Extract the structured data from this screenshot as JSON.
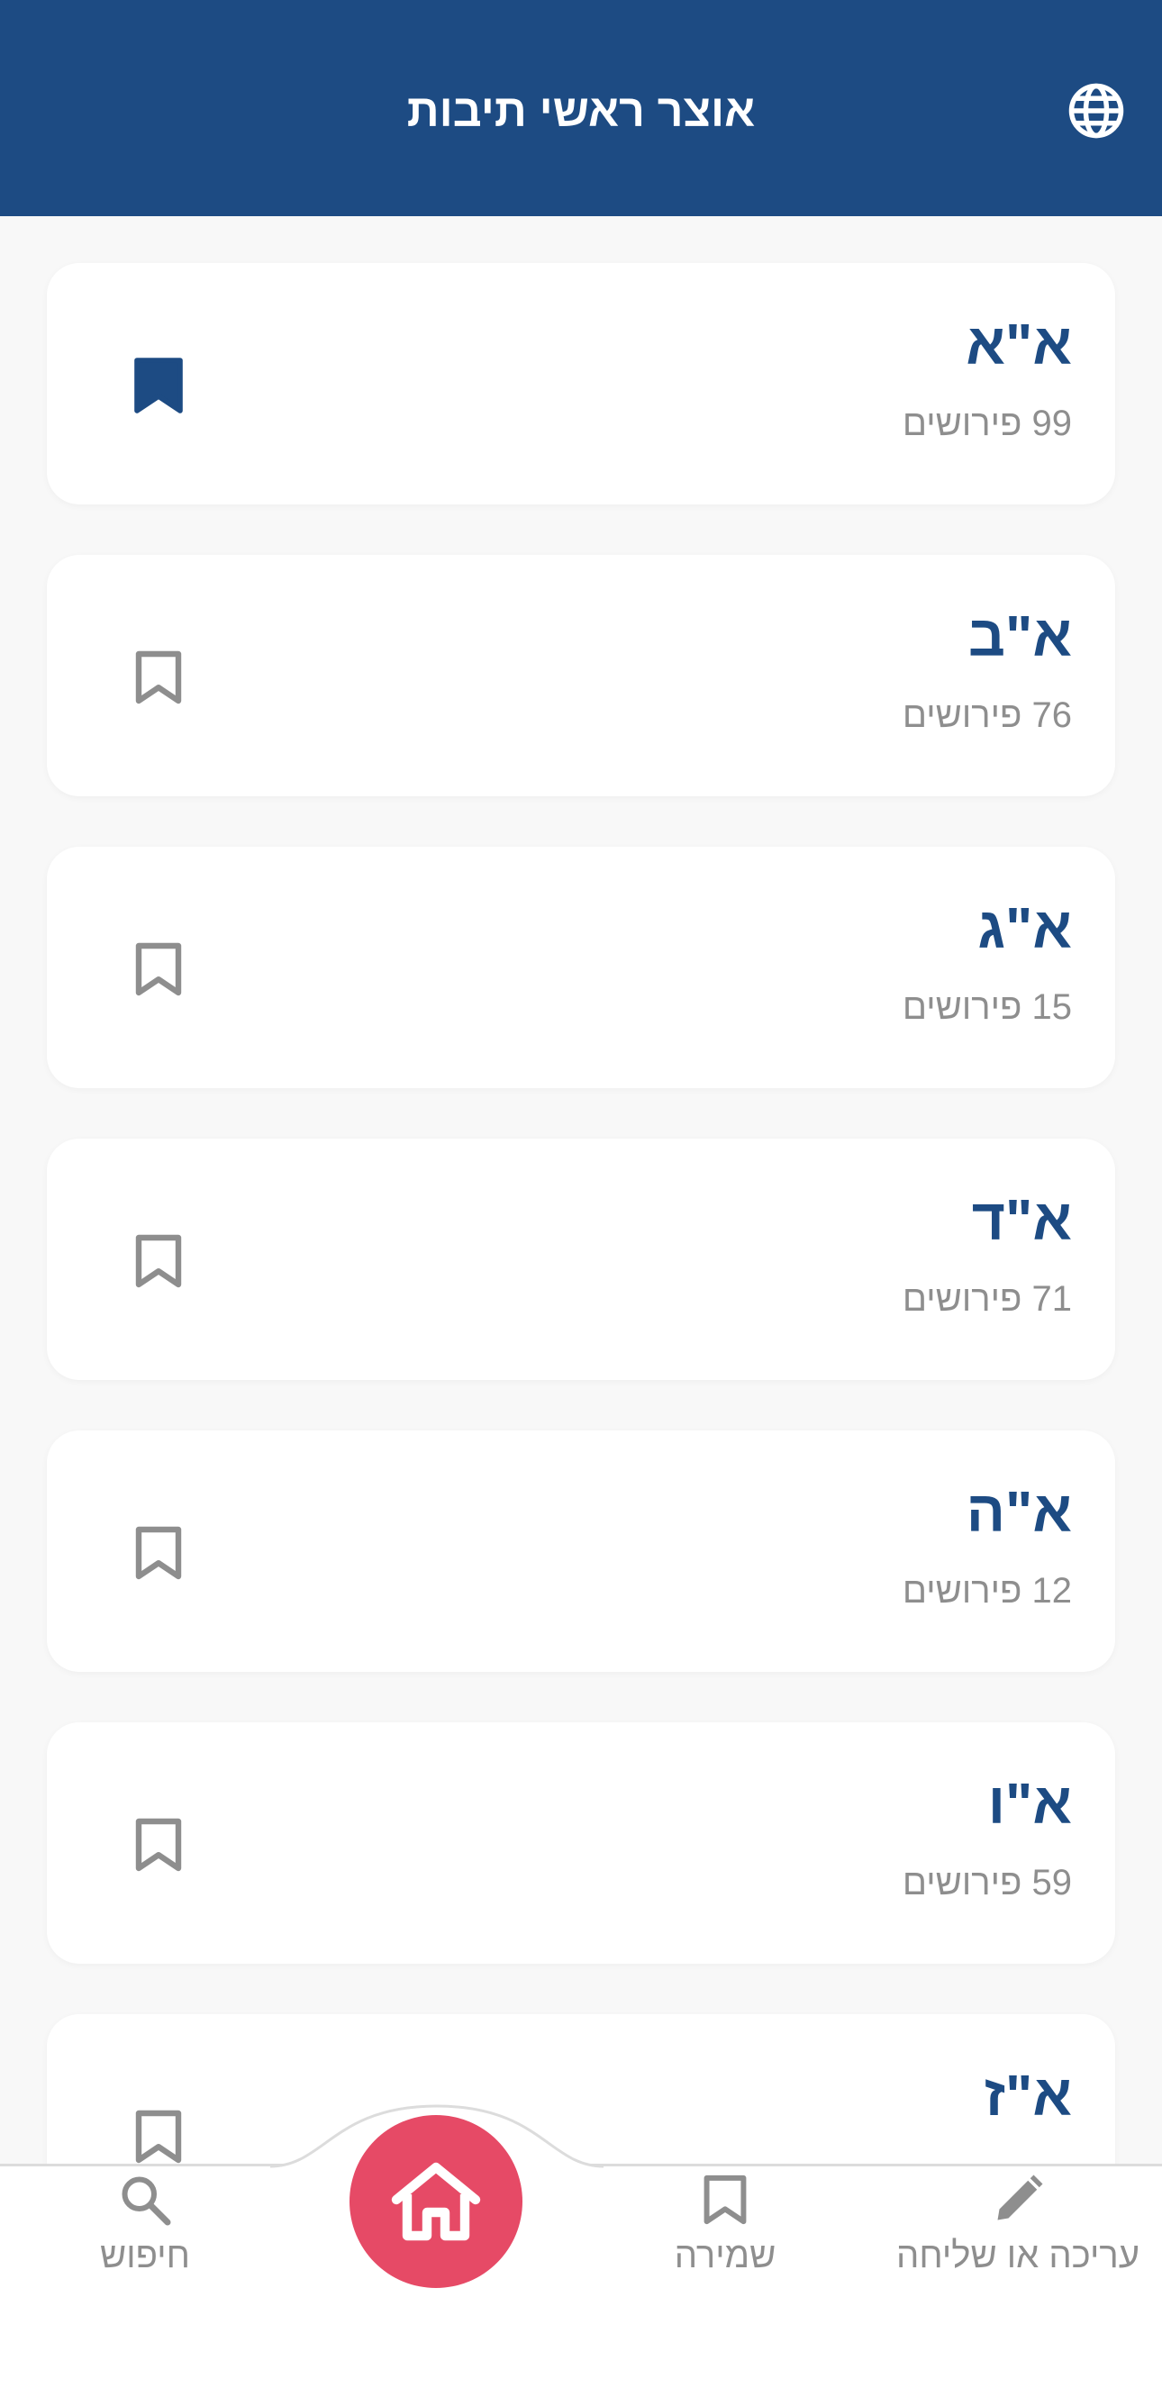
{
  "header": {
    "title": "אוצר ראשי תיבות",
    "language_icon": "globe-icon"
  },
  "colors": {
    "brand": "#1d4b83",
    "accent": "#e64a66",
    "muted": "#8e8e8e"
  },
  "items": [
    {
      "abbr": "א\"א",
      "count": "99 פירושים",
      "saved": true
    },
    {
      "abbr": "א\"ב",
      "count": "76 פירושים",
      "saved": false
    },
    {
      "abbr": "א\"ג",
      "count": "15 פירושים",
      "saved": false
    },
    {
      "abbr": "א\"ד",
      "count": "71 פירושים",
      "saved": false
    },
    {
      "abbr": "א\"ה",
      "count": "12 פירושים",
      "saved": false
    },
    {
      "abbr": "א\"ו",
      "count": "59 פירושים",
      "saved": false
    },
    {
      "abbr": "א\"ז",
      "count": "",
      "saved": false
    }
  ],
  "nav": {
    "search": {
      "label": "חיפוש",
      "icon": "search-icon"
    },
    "home": {
      "icon": "home-icon"
    },
    "saved": {
      "label": "שמירה",
      "icon": "bookmark-icon"
    },
    "edit": {
      "label": "עריכה או שליחה",
      "icon": "pencil-icon"
    }
  }
}
